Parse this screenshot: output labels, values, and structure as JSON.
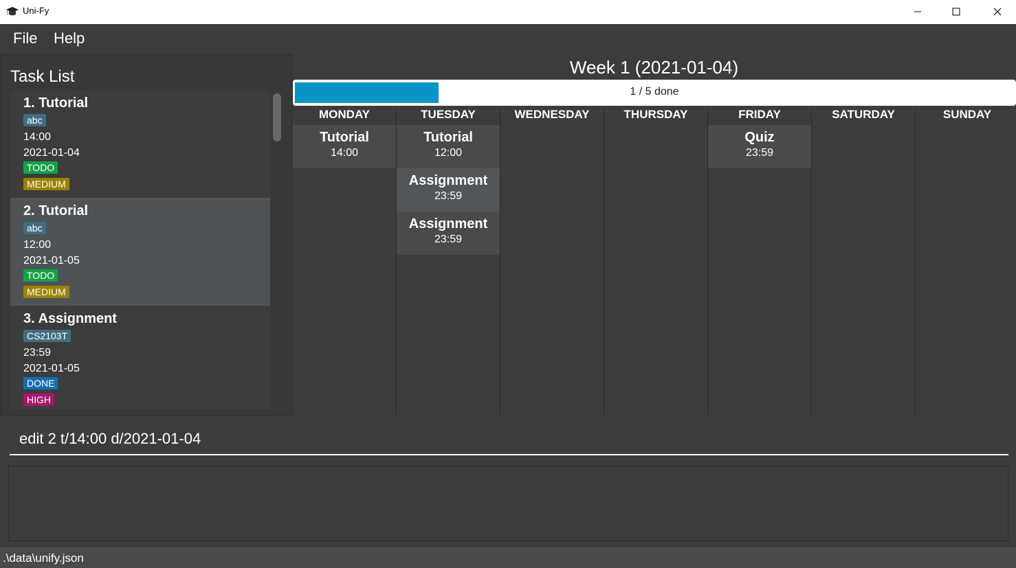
{
  "window": {
    "title": "Uni-Fy"
  },
  "menu": {
    "file": "File",
    "help": "Help"
  },
  "task_list": {
    "title": "Task List",
    "tasks": [
      {
        "index_title": "1.  Tutorial",
        "tag": "abc",
        "time": "14:00",
        "date": "2021-01-04",
        "status": "TODO",
        "priority": "MEDIUM"
      },
      {
        "index_title": "2.  Tutorial",
        "tag": "abc",
        "time": "12:00",
        "date": "2021-01-05",
        "status": "TODO",
        "priority": "MEDIUM"
      },
      {
        "index_title": "3.  Assignment",
        "tag": "CS2103T",
        "time": "23:59",
        "date": "2021-01-05",
        "status": "DONE",
        "priority": "HIGH"
      }
    ]
  },
  "week": {
    "title": "Week 1 (2021-01-04)",
    "progress": {
      "label": "1 / 5 done",
      "fraction": 0.2
    },
    "days": [
      {
        "name": "MONDAY",
        "events": [
          {
            "title": "Tutorial",
            "time": "14:00"
          }
        ]
      },
      {
        "name": "TUESDAY",
        "events": [
          {
            "title": "Tutorial",
            "time": "12:00"
          },
          {
            "title": "Assignment",
            "time": "23:59"
          },
          {
            "title": "Assignment",
            "time": "23:59"
          }
        ]
      },
      {
        "name": "WEDNESDAY",
        "events": []
      },
      {
        "name": "THURSDAY",
        "events": []
      },
      {
        "name": "FRIDAY",
        "events": [
          {
            "title": "Quiz",
            "time": "23:59"
          }
        ]
      },
      {
        "name": "SATURDAY",
        "events": []
      },
      {
        "name": "SUNDAY",
        "events": []
      }
    ]
  },
  "command": {
    "value": "edit 2 t/14:00 d/2021-01-04"
  },
  "status_bar": {
    "path": ".\\data\\unify.json"
  },
  "colors": {
    "progress_fill": "#0a93c7",
    "todo": "#15a14a",
    "done": "#156fad",
    "medium": "#9a8200",
    "high": "#a9156d",
    "tag": "#3f6e83"
  },
  "icons": {
    "app": "graduation-cap-icon",
    "minimize": "minimize-icon",
    "maximize": "maximize-icon",
    "close": "close-icon"
  }
}
